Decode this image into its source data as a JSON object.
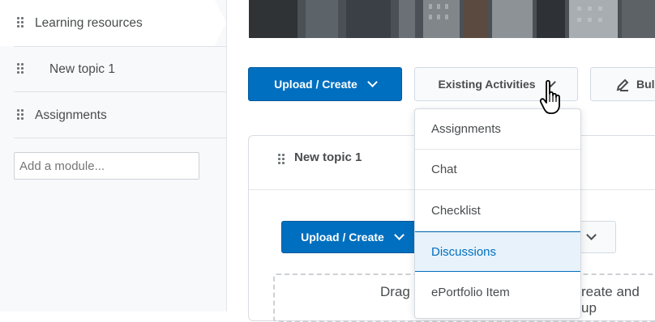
{
  "sidebar": {
    "items": [
      {
        "label": "Learning resources",
        "active": true
      },
      {
        "label": "New topic 1",
        "active": false
      },
      {
        "label": "Assignments",
        "active": false
      }
    ],
    "add_module_placeholder": "Add a module..."
  },
  "toolbar": {
    "upload_create_label": "Upload / Create",
    "existing_activities_label": "Existing Activities",
    "bulk_edit_label": "Bul"
  },
  "topic_panel": {
    "title": "New topic 1",
    "upload_create_label": "Upload / Create",
    "drop_text_left": "Drag",
    "drop_text_right": "reate and up"
  },
  "existing_activities_menu": {
    "items": [
      "Assignments",
      "Chat",
      "Checklist",
      "Discussions",
      "ePortfolio Item"
    ],
    "highlighted": "Discussions"
  },
  "colors": {
    "primary": "#006fbf",
    "sidebar_bg": "#f8f9fb",
    "highlight_bg": "#e8f2fa"
  }
}
